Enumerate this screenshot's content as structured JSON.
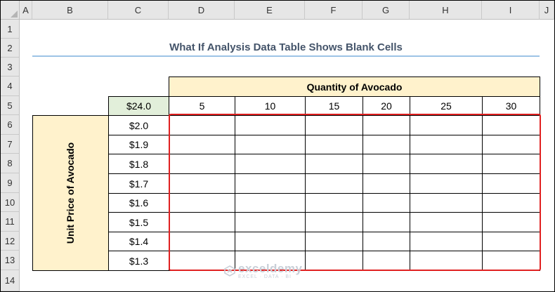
{
  "columns": [
    "A",
    "B",
    "C",
    "D",
    "E",
    "F",
    "G",
    "H",
    "I",
    "J"
  ],
  "rows": [
    "1",
    "2",
    "3",
    "4",
    "5",
    "6",
    "7",
    "8",
    "9",
    "10",
    "11",
    "12",
    "13",
    "14"
  ],
  "title": "What If Analysis Data Table Shows Blank Cells",
  "quantity_header": "Quantity of Avocado",
  "formula_cell": "$24.0",
  "quantities": [
    "5",
    "10",
    "15",
    "20",
    "25",
    "30"
  ],
  "row_label": "Unit Price of Avocado",
  "prices": [
    "$2.0",
    "$1.9",
    "$1.8",
    "$1.7",
    "$1.6",
    "$1.5",
    "$1.4",
    "$1.3"
  ],
  "watermark": {
    "name": "exceldemy",
    "tagline": "EXCEL · DATA · BI"
  },
  "colors": {
    "header_fill": "#fff2cc",
    "formula_fill": "#e2efda",
    "title_text": "#44546a",
    "highlight_border": "#e02020",
    "title_underline": "#9dc3e6"
  }
}
